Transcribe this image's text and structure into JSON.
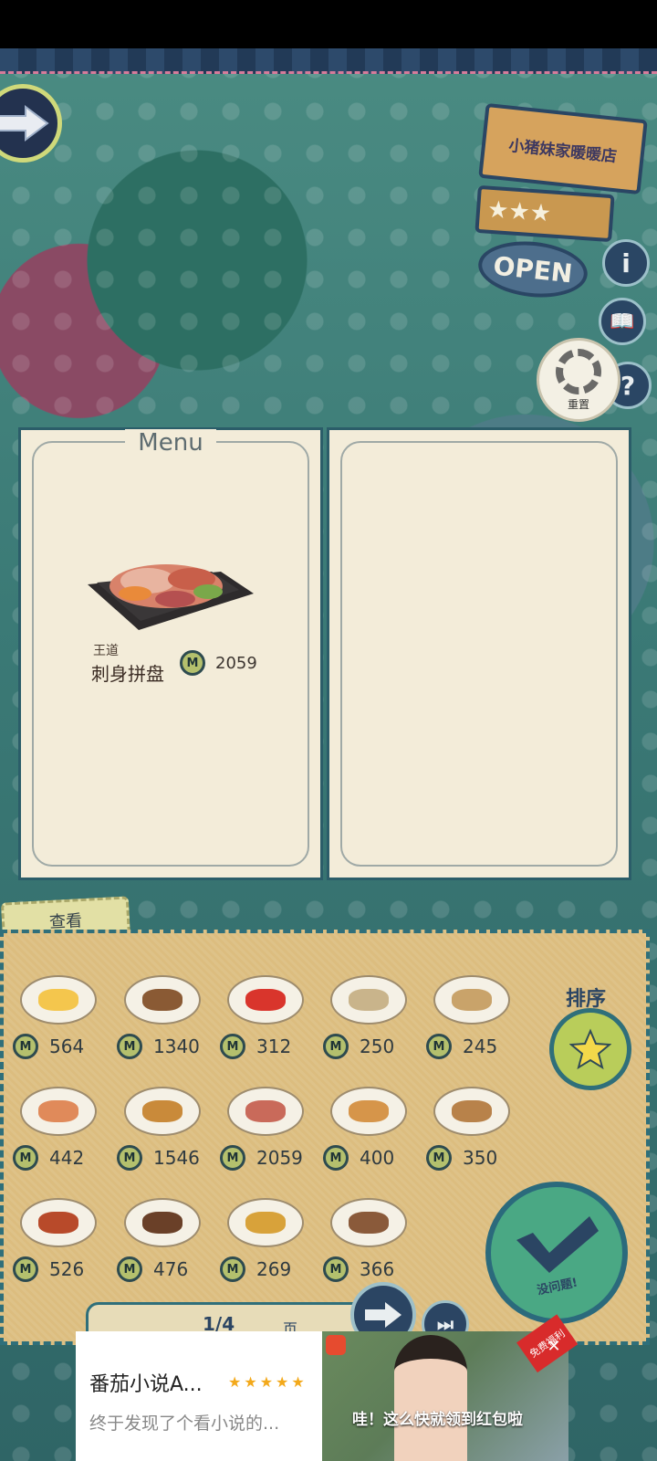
{
  "shop": {
    "name": "小猪妹家暖暖店",
    "rating_stars": "★★★",
    "open_label": "OPEN",
    "reset_label": "重置"
  },
  "side_icons": {
    "info": "i",
    "book": "📖",
    "help": "?"
  },
  "menu": {
    "title": "Menu",
    "featured": {
      "tag": "王道",
      "name": "刺身拼盘",
      "coin_symbol": "M",
      "price": "2059"
    }
  },
  "dish_panel": {
    "view_tab_label": "查看",
    "sort_label": "排序",
    "confirm_label": "没问题!",
    "coin_symbol": "M",
    "dishes": [
      {
        "price": "564",
        "color": "#f4c64d"
      },
      {
        "price": "1340",
        "color": "#8a5a34"
      },
      {
        "price": "312",
        "color": "#d9352c"
      },
      {
        "price": "250",
        "color": "#c9b48b"
      },
      {
        "price": "245",
        "color": "#c9a36a"
      },
      {
        "price": "442",
        "color": "#e08a5a"
      },
      {
        "price": "1546",
        "color": "#c98a3a"
      },
      {
        "price": "2059",
        "color": "#c96a5a"
      },
      {
        "price": "400",
        "color": "#d6954a"
      },
      {
        "price": "350",
        "color": "#b8824a"
      },
      {
        "price": "526",
        "color": "#b84a2a"
      },
      {
        "price": "476",
        "color": "#6a4028"
      },
      {
        "price": "269",
        "color": "#d8a23a"
      },
      {
        "price": "366",
        "color": "#8a5a3a"
      }
    ]
  },
  "pager": {
    "indicator": "1/4",
    "unit": "页"
  },
  "ad": {
    "title": "番茄小说A...",
    "stars": "★★★★★",
    "description": "终于发现了个看小说的...",
    "caption": "哇！这么快就领到红包啦",
    "badge": "免费福利",
    "close": "✕"
  }
}
